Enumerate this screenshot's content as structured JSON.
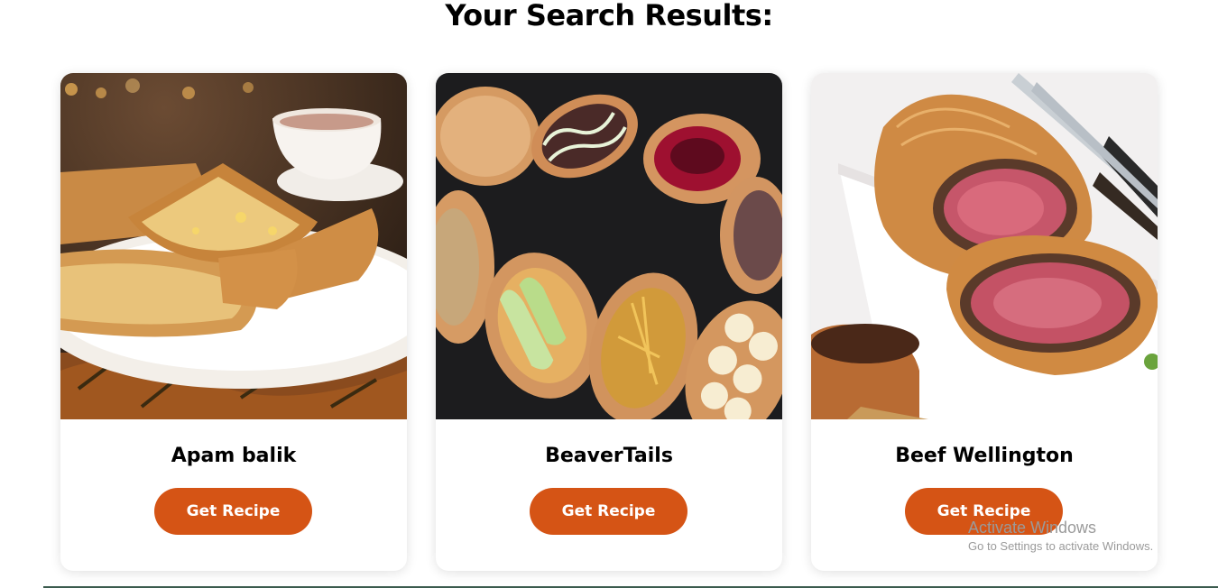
{
  "page": {
    "heading": "Your Search Results:"
  },
  "recipes": [
    {
      "title": "Apam balik",
      "button": "Get Recipe",
      "image": "apam-balik-photo"
    },
    {
      "title": "BeaverTails",
      "button": "Get Recipe",
      "image": "beavertails-photo"
    },
    {
      "title": "Beef Wellington",
      "button": "Get Recipe",
      "image": "beef-wellington-photo"
    }
  ],
  "watermark": {
    "title": "Activate Windows",
    "subtitle": "Go to Settings to activate Windows."
  },
  "colors": {
    "accent": "#d55415",
    "text": "#000000",
    "background": "#ffffff"
  }
}
